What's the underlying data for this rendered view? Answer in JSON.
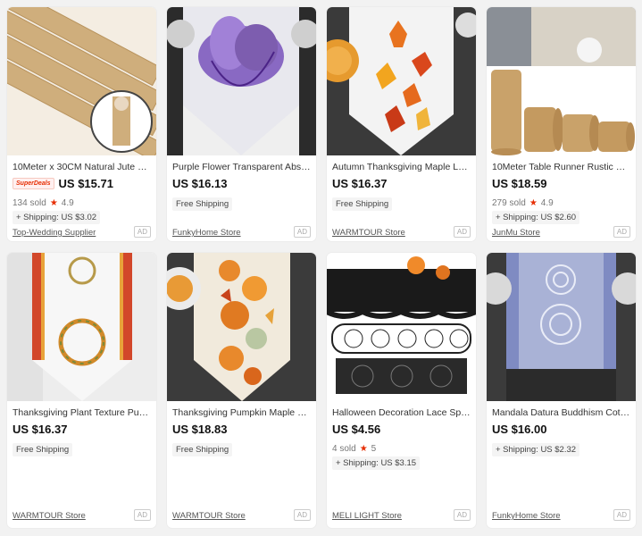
{
  "products": [
    {
      "title": "10Meter x 30CM Natural Jute Hess...",
      "superdeals": "SuperDeals",
      "price": "US $15.71",
      "sold": "134 sold",
      "rating": "4.9",
      "shipping": "+ Shipping: US $3.02",
      "store": "Top-Wedding Supplier",
      "ad": "AD",
      "thumb_icon": "jute-runner-image"
    },
    {
      "title": "Purple Flower Transparent Abstrac...",
      "price": "US $16.13",
      "shipping": "Free Shipping",
      "store": "FunkyHome Store",
      "ad": "AD",
      "thumb_icon": "purple-flower-runner-image"
    },
    {
      "title": "Autumn Thanksgiving Maple Leaf ...",
      "price": "US $16.37",
      "shipping": "Free Shipping",
      "store": "WARMTOUR Store",
      "ad": "AD",
      "thumb_icon": "maple-leaf-runner-image"
    },
    {
      "title": "10Meter Table Runner Rustic Ribb...",
      "price": "US $18.59",
      "sold": "279 sold",
      "rating": "4.9",
      "shipping": "+ Shipping: US $2.60",
      "store": "JunMu Store",
      "ad": "AD",
      "thumb_icon": "burlap-rolls-image"
    },
    {
      "title": "Thanksgiving Plant Texture Pumpk...",
      "price": "US $16.37",
      "shipping": "Free Shipping",
      "store": "WARMTOUR Store",
      "ad": "AD",
      "thumb_icon": "plant-wreath-runner-image"
    },
    {
      "title": "Thanksgiving Pumpkin Maple Leaf ...",
      "price": "US $18.83",
      "shipping": "Free Shipping",
      "store": "WARMTOUR Store",
      "ad": "AD",
      "thumb_icon": "pumpkin-runner-image"
    },
    {
      "title": "Halloween Decoration Lace Spider...",
      "price": "US $4.56",
      "sold": "4 sold",
      "rating": "5",
      "shipping": "+ Shipping: US $3.15",
      "store": "MELI LIGHT Store",
      "ad": "AD",
      "thumb_icon": "spiderweb-lace-image"
    },
    {
      "title": "Mandala Datura Buddhism Cotton...",
      "price": "US $16.00",
      "shipping": "+ Shipping: US $2.32",
      "store": "FunkyHome Store",
      "ad": "AD",
      "thumb_icon": "mandala-runner-image"
    }
  ],
  "colors": {
    "accent": "#e62e04",
    "page_bg": "#f2f2f2"
  }
}
